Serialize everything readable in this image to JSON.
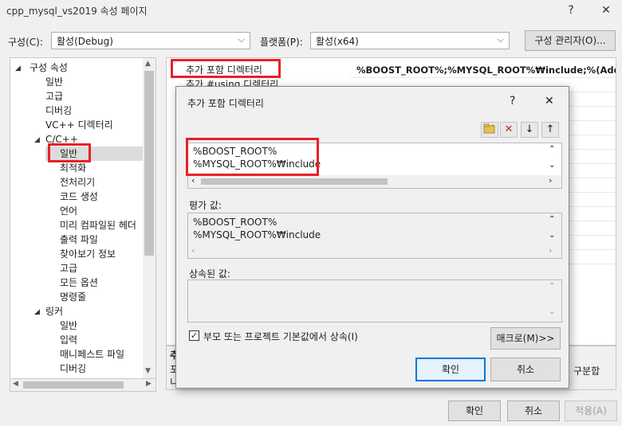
{
  "window": {
    "title": "cpp_mysql_vs2019 속성 페이지",
    "help_glyph": "?",
    "close_glyph": "✕"
  },
  "config_bar": {
    "config_label": "구성(C):",
    "config_value": "활성(Debug)",
    "platform_label": "플랫폼(P):",
    "platform_value": "활성(x64)",
    "manager_button": "구성 관리자(O)..."
  },
  "tree": {
    "items": [
      {
        "label": "구성 속성"
      },
      {
        "label": "일반"
      },
      {
        "label": "고급"
      },
      {
        "label": "디버깅"
      },
      {
        "label": "VC++ 디렉터리"
      },
      {
        "label": "C/C++"
      },
      {
        "label": "일반"
      },
      {
        "label": "최적화"
      },
      {
        "label": "전처리기"
      },
      {
        "label": "코드 생성"
      },
      {
        "label": "언어"
      },
      {
        "label": "미리 컴파일된 헤더"
      },
      {
        "label": "출력 파일"
      },
      {
        "label": "찾아보기 정보"
      },
      {
        "label": "고급"
      },
      {
        "label": "모든 옵션"
      },
      {
        "label": "명령줄"
      },
      {
        "label": "링커"
      },
      {
        "label": "일반"
      },
      {
        "label": "입력"
      },
      {
        "label": "매니페스트 파일"
      },
      {
        "label": "디버깅"
      }
    ]
  },
  "grid": {
    "row1_name": "추가 포함 디렉터리",
    "row1_value": "%BOOST_ROOT%;%MYSQL_ROOT%₩include;%(AdditionalIncludeDirectories)",
    "row2_name": "추가 #using 디렉터리",
    "desc_title": "추가",
    "desc_line1": "포함",
    "desc_line2": "니다",
    "desc_tail": "구분합"
  },
  "dialog": {
    "title": "추가 포함 디렉터리",
    "help_glyph": "?",
    "close_glyph": "✕",
    "paths": [
      "%BOOST_ROOT%",
      "%MYSQL_ROOT%₩include"
    ],
    "evaluated_label": "평가 값:",
    "evaluated": [
      "%BOOST_ROOT%",
      "%MYSQL_ROOT%₩include"
    ],
    "inherited_label": "상속된 값:",
    "inherit_checkbox_label": "부모 또는 프로젝트 기본값에서 상속(I)",
    "inherit_checked": true,
    "macros_button": "매크로(M)>>",
    "ok_button": "확인",
    "cancel_button": "취소"
  },
  "footer": {
    "ok": "확인",
    "cancel": "취소",
    "apply": "적용(A)"
  },
  "colors": {
    "highlight": "#e8202a",
    "accent": "#0078d7",
    "background": "#f0f0f0"
  }
}
